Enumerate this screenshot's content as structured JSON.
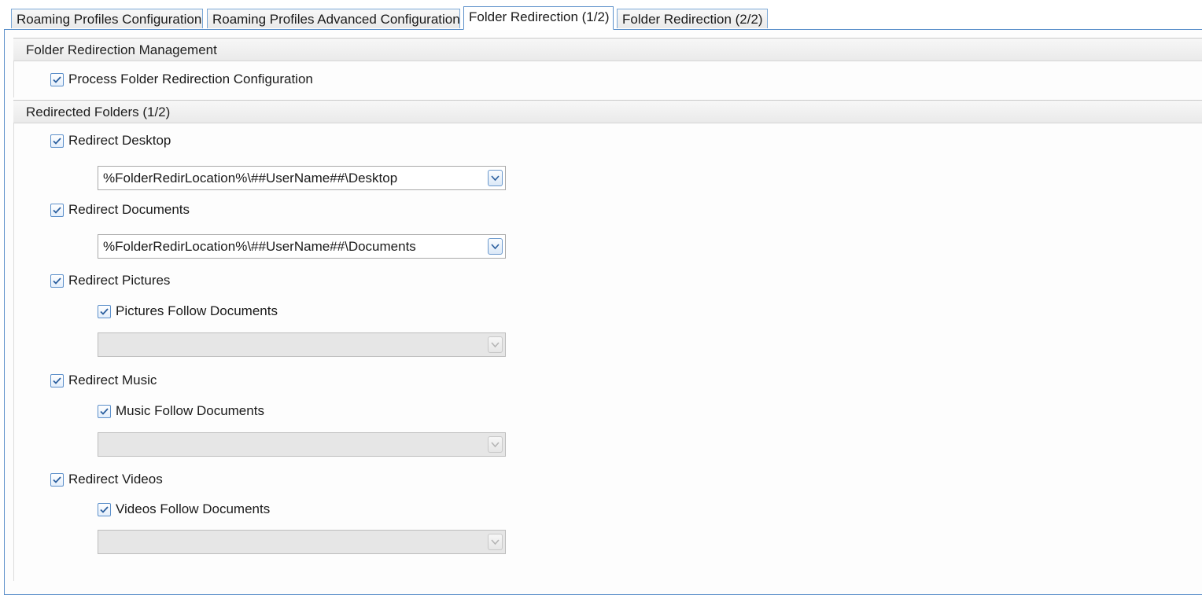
{
  "tabs": [
    {
      "label": "Roaming Profiles Configuration",
      "active": false
    },
    {
      "label": "Roaming Profiles Advanced Configuration",
      "active": false
    },
    {
      "label": "Folder Redirection (1/2)",
      "active": true
    },
    {
      "label": "Folder Redirection (2/2)",
      "active": false
    }
  ],
  "management": {
    "header": "Folder Redirection Management",
    "process_label": "Process Folder Redirection Configuration",
    "process_checked": true
  },
  "redirected": {
    "header": "Redirected Folders (1/2)",
    "desktop": {
      "label": "Redirect Desktop",
      "checked": true,
      "path": "%FolderRedirLocation%\\##UserName##\\Desktop"
    },
    "documents": {
      "label": "Redirect Documents",
      "checked": true,
      "path": "%FolderRedirLocation%\\##UserName##\\Documents"
    },
    "pictures": {
      "label": "Redirect Pictures",
      "checked": true,
      "follow_label": "Pictures Follow Documents",
      "follow_checked": true,
      "path": ""
    },
    "music": {
      "label": "Redirect Music",
      "checked": true,
      "follow_label": "Music Follow Documents",
      "follow_checked": true,
      "path": ""
    },
    "videos": {
      "label": "Redirect Videos",
      "checked": true,
      "follow_label": "Videos Follow Documents",
      "follow_checked": true,
      "path": ""
    }
  },
  "colors": {
    "accent": "#5b8fca",
    "disabled_field": "#e6e6e6"
  }
}
